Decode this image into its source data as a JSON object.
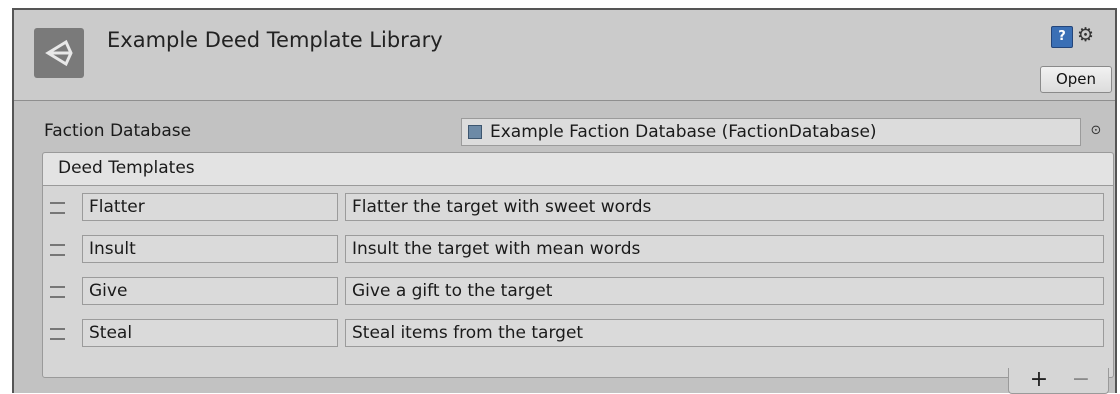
{
  "inspector": {
    "title": "Example Deed Template Library",
    "help_icon_glyph": "?",
    "settings_icon_glyph": "⚙",
    "open_label": "Open"
  },
  "faction_database": {
    "label": "Faction Database",
    "value": "Example Faction Database (FactionDatabase)",
    "picker_glyph": "⊙"
  },
  "deed_templates": {
    "header": "Deed Templates",
    "items": [
      {
        "name": "Flatter",
        "description": "Flatter the target with sweet words"
      },
      {
        "name": "Insult",
        "description": "Insult the target with mean words"
      },
      {
        "name": "Give",
        "description": "Give a gift to the target"
      },
      {
        "name": "Steal",
        "description": "Steal items from the target"
      }
    ],
    "add_glyph": "+",
    "remove_glyph": "−"
  }
}
